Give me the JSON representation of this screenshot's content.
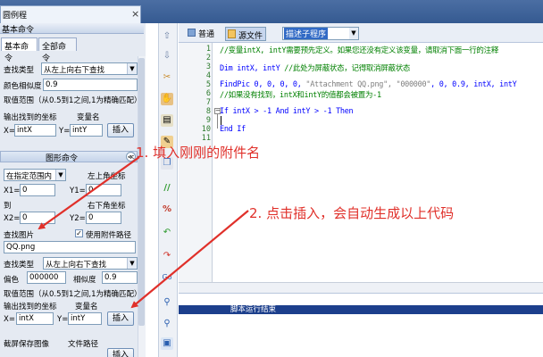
{
  "window": {
    "tab_title": "圆例程",
    "tab_close": "×"
  },
  "left_panel": {
    "basic_section": "基本命令",
    "tabs": [
      "基本命令",
      "全部命令"
    ],
    "find_type_label": "查找类型",
    "find_type_value": "从左上向右下查找",
    "similarity_label": "颜色相似度",
    "similarity_value": "0.9",
    "hint": "取值范围（从0.5到1之间,1为精确匹配）",
    "output_label": "输出找到的坐标",
    "var_label": "变量名",
    "x_label": "X=",
    "x_value": "intX",
    "y_label": "Y=",
    "y_value": "intY",
    "insert_label": "插入",
    "graph_section": "图形命令",
    "graph_collapse": "≪",
    "range_value": "在指定范围内",
    "topleft_label": "左上角坐标",
    "x1_label": "X1=",
    "x1_value": "0",
    "y1_label": "Y1=",
    "y1_value": "0",
    "to_label": "到",
    "bottomright_label": "右下角坐标",
    "x2_label": "X2=",
    "x2_value": "0",
    "y2_label": "Y2=",
    "y2_value": "0",
    "find_image_label": "查找图片",
    "use_path_label": "使用附件路径",
    "use_path_checked": "✓",
    "image_value": "QQ.png",
    "find_type2_label": "查找类型",
    "find_type2_value": "从左上向右下查找",
    "tolerance_label": "偏色",
    "tolerance_value": "000000",
    "similarity2_label": "相似度",
    "similarity2_value": "0.9",
    "hint2": "取值范围（从0.5到1之间,1为精确匹配）",
    "output2_label": "输出找到的坐标",
    "var2_label": "变量名",
    "x2b_label": "X=",
    "x2b_value": "intX",
    "y2b_label": "Y=",
    "y2b_value": "intY",
    "insert2_label": "插入",
    "screenshot_label": "截屏保存图像",
    "filepath_label": "文件路径",
    "insert3_label": "插入"
  },
  "editor": {
    "normal_btn": "普通",
    "source_btn": "源文件",
    "proc_combo": "描述子程序",
    "line_numbers": [
      "1",
      "2",
      "3",
      "4",
      "5",
      "6",
      "7",
      "8",
      "9",
      "10",
      "11"
    ],
    "lines": {
      "l1": "//变量intX, intY需要预先定义。如果您还没有定义该变量，请取消下面一行的注释",
      "l3_kw": "Dim intX, intY",
      "l3_cmt": "  //此处为屏蔽状态，记得取消屏蔽状态",
      "l5_kw": "FindPic",
      "l5_args": " 0, 0, 0, 0, ",
      "l5_str": "\"Attachment QQ.png\", \"000000\"",
      "l5_rest": ", 0, 0.9, intX, intY",
      "l6": "//如果没有找到，intX和intY的值都会被置为-1",
      "l8_if": "If",
      "l8_mid": " intX > -1 ",
      "l8_and": "And",
      "l8_mid2": " intY > -1 ",
      "l8_then": "Then",
      "l10": "End If"
    },
    "fold_minus": "−",
    "output_text": "脚本运行结束"
  },
  "annotations": {
    "step1": "1. 填入刚刚的附件名",
    "step2": "2. 点击插入，会自动生成以上代码"
  },
  "colors": {
    "annotation": "#e0302a",
    "titlebar": "#3d6298",
    "output_bar": "#1c3f8c"
  }
}
